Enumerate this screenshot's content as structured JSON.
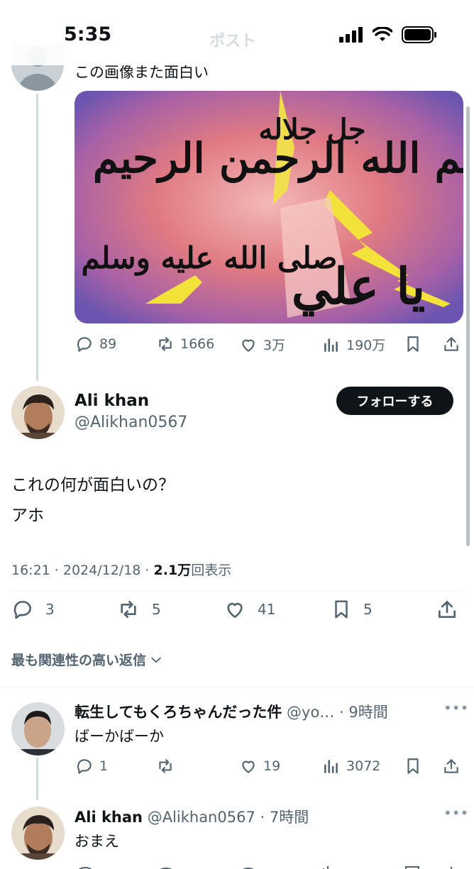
{
  "status_bar": {
    "time": "5:35"
  },
  "header": {
    "title": "ポスト"
  },
  "parent_post": {
    "text": "この画像また面白い",
    "image_text_1": "بسم الله الرحمن الرحيم",
    "image_text_2": "جل جلاله",
    "image_text_3": "صلى الله عليه وسلم",
    "image_text_4": "يا علي",
    "actions": {
      "replies": "89",
      "reposts": "1666",
      "likes": "3万",
      "views": "190万"
    }
  },
  "main_post": {
    "author_name": "Ali khan",
    "handle": "@Alikhan0567",
    "follow_label": "フォローする",
    "text_line1": "これの何が面白いの？",
    "text_line2": "アホ",
    "meta_time": "16:21 · 2024/12/18 · ",
    "meta_views": "2.1万",
    "meta_views_label": "回表示",
    "actions": {
      "replies": "3",
      "reposts": "5",
      "likes": "41",
      "bookmarks": "5"
    }
  },
  "replies_sort": {
    "label": "最も関連性の高い返信"
  },
  "reply_1": {
    "author_name": "転生してもくろちゃんだった件",
    "handle": "@yo…",
    "time": "· 9時間",
    "text": "ばーかばーか",
    "actions": {
      "replies": "1",
      "reposts": "",
      "likes": "19",
      "views": "3072"
    }
  },
  "reply_2": {
    "author_name": "Ali khan",
    "handle": "@Alikhan0567",
    "time": "· 7時間",
    "text": "おまえ"
  },
  "colors": {
    "accent": "#0f1419",
    "muted": "#536471",
    "divider": "#eff3f4"
  },
  "icons": [
    "reply-icon",
    "repost-icon",
    "like-icon",
    "views-icon",
    "bookmark-icon",
    "share-icon",
    "chevron-down-icon",
    "more-icon"
  ]
}
